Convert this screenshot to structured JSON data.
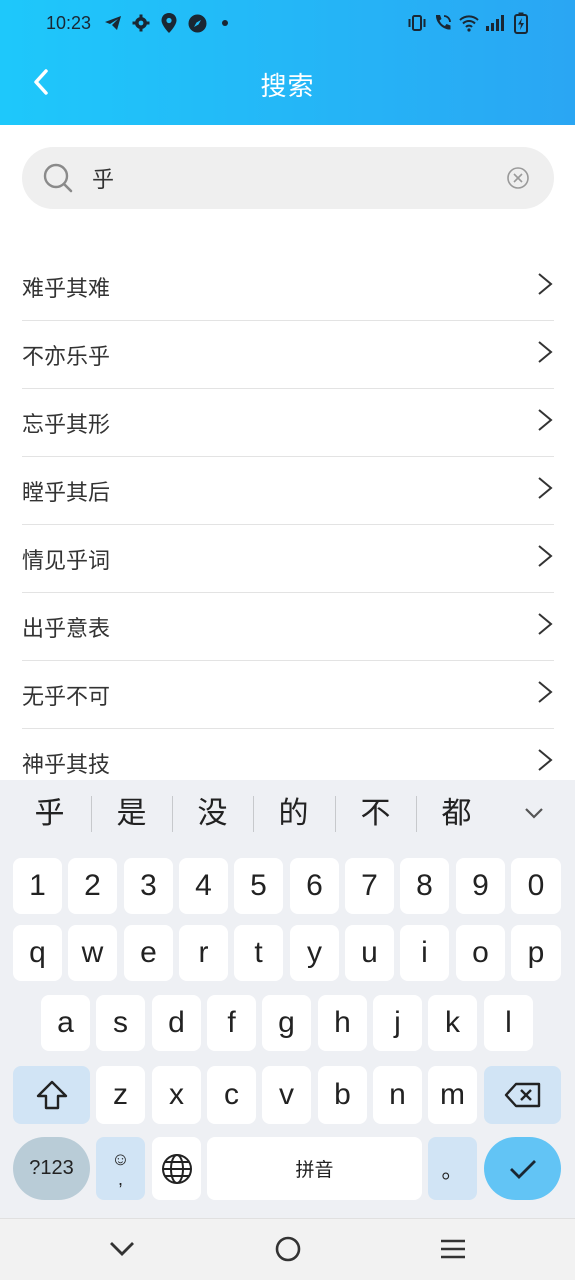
{
  "status_bar": {
    "time": "10:23",
    "left_icons": [
      "telegram-icon",
      "settings-icon",
      "location-icon",
      "compass-icon",
      "dot-icon"
    ],
    "right_icons": [
      "vibrate-icon",
      "wifi-call-icon",
      "wifi-icon",
      "signal-icon",
      "battery-icon"
    ]
  },
  "header": {
    "title": "搜索",
    "background": "#1ec8fb",
    "back_icon": "chevron-left-icon"
  },
  "search": {
    "value": "乎",
    "placeholder": ""
  },
  "results": [
    {
      "label": "难乎其难"
    },
    {
      "label": "不亦乐乎"
    },
    {
      "label": "忘乎其形"
    },
    {
      "label": "瞠乎其后"
    },
    {
      "label": "情见乎词"
    },
    {
      "label": "出乎意表"
    },
    {
      "label": "无乎不可"
    },
    {
      "label": "神乎其技"
    }
  ],
  "keyboard": {
    "candidates": [
      "乎",
      "是",
      "没",
      "的",
      "不",
      "都"
    ],
    "row_digits": [
      "1",
      "2",
      "3",
      "4",
      "5",
      "6",
      "7",
      "8",
      "9",
      "0"
    ],
    "row_1": [
      "q",
      "w",
      "e",
      "r",
      "t",
      "y",
      "u",
      "i",
      "o",
      "p"
    ],
    "row_2": [
      "a",
      "s",
      "d",
      "f",
      "g",
      "h",
      "j",
      "k",
      "l"
    ],
    "row_3": [
      "z",
      "x",
      "c",
      "v",
      "b",
      "n",
      "m"
    ],
    "sym_key": "?123",
    "emoji_comma_top": "☺",
    "emoji_comma_bottom": ",",
    "space_label": "拼音",
    "period_key": "。",
    "enter_color": "#62c4f5"
  },
  "navbar": {
    "icons": [
      "nav-back-icon",
      "home-icon",
      "recents-icon"
    ]
  }
}
